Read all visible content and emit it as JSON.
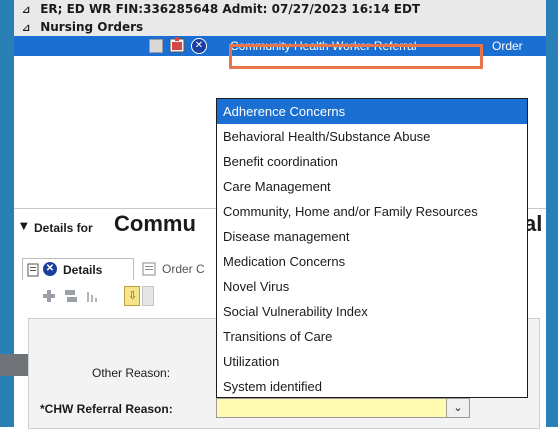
{
  "header": {
    "encounter": "ER; ED WR FIN:336285648  Admit: 07/27/2023 16:14 EDT",
    "nursing_orders": "Nursing Orders",
    "expand_glyph": "⊿"
  },
  "order_row": {
    "order_name": "Community Health Worker Referral",
    "order_type": "Order"
  },
  "details": {
    "prefix": "Details for",
    "title_left": "Commu",
    "title_right": "al",
    "collapse_glyph": "▼"
  },
  "tabs": [
    {
      "label": "Details"
    },
    {
      "label": "Order C"
    }
  ],
  "form": {
    "other_reason_label": "Other Reason:",
    "chw_reason_label": "*CHW Referral Reason:",
    "chw_reason_value": "",
    "dropdown_glyph": "⌄"
  },
  "dropdown": {
    "options": [
      "Adherence Concerns",
      "Behavioral Health/Substance Abuse",
      "Benefit coordination",
      "Care Management",
      "Community, Home and/or Family Resources",
      "Disease management",
      "Medication Concerns",
      "Novel Virus",
      "Social Vulnerability Index",
      "Transitions of Care",
      "Utilization",
      "System identified"
    ],
    "selected_index": 0
  },
  "icons": {
    "checkbox": "checkbox-icon",
    "rx": "prescription-icon",
    "cancel": "cancel-circle-icon",
    "plus": "add-icon",
    "docs": "documents-icon",
    "chart": "chart-icon",
    "arrow_down": "arrow-down-icon"
  },
  "colors": {
    "selection_blue": "#1b6fd3",
    "highlight_orange": "#e8744b",
    "required_yellow": "#fffbb0"
  }
}
